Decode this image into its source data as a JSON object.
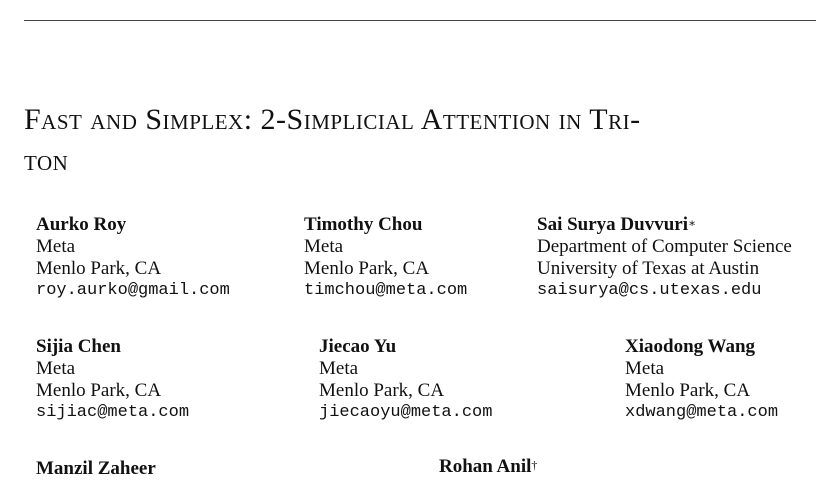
{
  "paper": {
    "title": "Fast and Simplex: 2-Simplicial Attention in Triton",
    "title_line1": "Fast and Simplex: 2-Simplicial Attention in Tri-",
    "title_line2": "ton"
  },
  "authors": [
    {
      "name": "Aurko Roy",
      "mark": "",
      "lines": [
        "Meta",
        "Menlo Park, CA"
      ],
      "email": "roy.aurko@gmail.com"
    },
    {
      "name": "Timothy Chou",
      "mark": "",
      "lines": [
        "Meta",
        "Menlo Park, CA"
      ],
      "email": "timchou@meta.com"
    },
    {
      "name": "Sai Surya Duvvuri",
      "mark": "∗",
      "lines": [
        "Department of Computer Science",
        "University of Texas at Austin"
      ],
      "email": "saisurya@cs.utexas.edu"
    },
    {
      "name": "Sijia Chen",
      "mark": "",
      "lines": [
        "Meta",
        "Menlo Park, CA"
      ],
      "email": "sijiac@meta.com"
    },
    {
      "name": "Jiecao Yu",
      "mark": "",
      "lines": [
        "Meta",
        "Menlo Park, CA"
      ],
      "email": "jiecaoyu@meta.com"
    },
    {
      "name": "Xiaodong Wang",
      "mark": "",
      "lines": [
        "Meta",
        "Menlo Park, CA"
      ],
      "email": "xdwang@meta.com"
    },
    {
      "name": "Manzil Zaheer",
      "mark": ""
    },
    {
      "name": "Rohan Anil",
      "mark": "†"
    }
  ]
}
